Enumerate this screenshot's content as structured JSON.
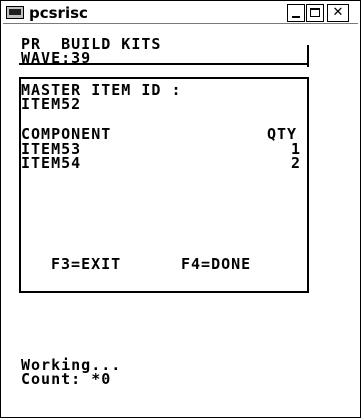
{
  "window": {
    "title": "pcsrisc",
    "icon": "terminal-icon",
    "controls": {
      "minimize": "minimize-icon",
      "maximize": "maximize-icon",
      "close_label": "✕"
    }
  },
  "header": {
    "line1": "PR  BUILD KITS",
    "line2": "WAVE:39"
  },
  "panel": {
    "master_label": "MASTER ITEM ID :",
    "master_value": "ITEM52",
    "columns": {
      "component": "COMPONENT",
      "qty": "QTY"
    },
    "rows": [
      {
        "component": "ITEM53",
        "qty": "1"
      },
      {
        "component": "ITEM54",
        "qty": "2"
      }
    ],
    "keys": {
      "f3": "F3=EXIT",
      "f4": "F4=DONE"
    }
  },
  "status": {
    "working": "Working...",
    "count": "Count: *0"
  }
}
